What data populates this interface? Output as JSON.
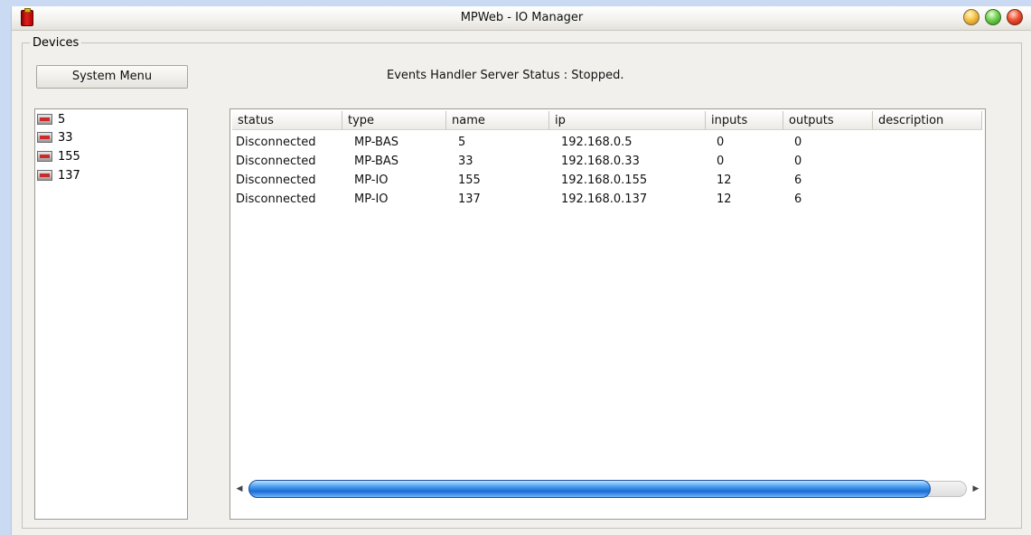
{
  "window": {
    "title": "MPWeb - IO Manager"
  },
  "devices": {
    "group_label": "Devices",
    "system_menu_label": "System Menu",
    "server_status": "Events Handler Server Status : Stopped.",
    "list": [
      {
        "label": "5",
        "icon": "device-icon"
      },
      {
        "label": "33",
        "icon": "device-icon"
      },
      {
        "label": "155",
        "icon": "device-icon"
      },
      {
        "label": "137",
        "icon": "device-icon"
      }
    ]
  },
  "table": {
    "columns": [
      "status",
      "type",
      "name",
      "ip",
      "inputs",
      "outputs",
      "description"
    ],
    "rows": [
      {
        "status": "Disconnected",
        "type": "MP-BAS",
        "name": "5",
        "ip": "192.168.0.5",
        "inputs": "0",
        "outputs": "0",
        "description": ""
      },
      {
        "status": "Disconnected",
        "type": "MP-BAS",
        "name": "33",
        "ip": "192.168.0.33",
        "inputs": "0",
        "outputs": "0",
        "description": ""
      },
      {
        "status": "Disconnected",
        "type": "MP-IO",
        "name": "155",
        "ip": "192.168.0.155",
        "inputs": "12",
        "outputs": "6",
        "description": ""
      },
      {
        "status": "Disconnected",
        "type": "MP-IO",
        "name": "137",
        "ip": "192.168.0.137",
        "inputs": "12",
        "outputs": "6",
        "description": ""
      }
    ]
  },
  "colors": {
    "desktop": "#c9daf2",
    "window_bg": "#f1f0ed",
    "scroll_thumb": "#1c6cd2",
    "close_button": "#f05030",
    "maximize_button": "#70d050",
    "minimize_button": "#f6c040"
  }
}
